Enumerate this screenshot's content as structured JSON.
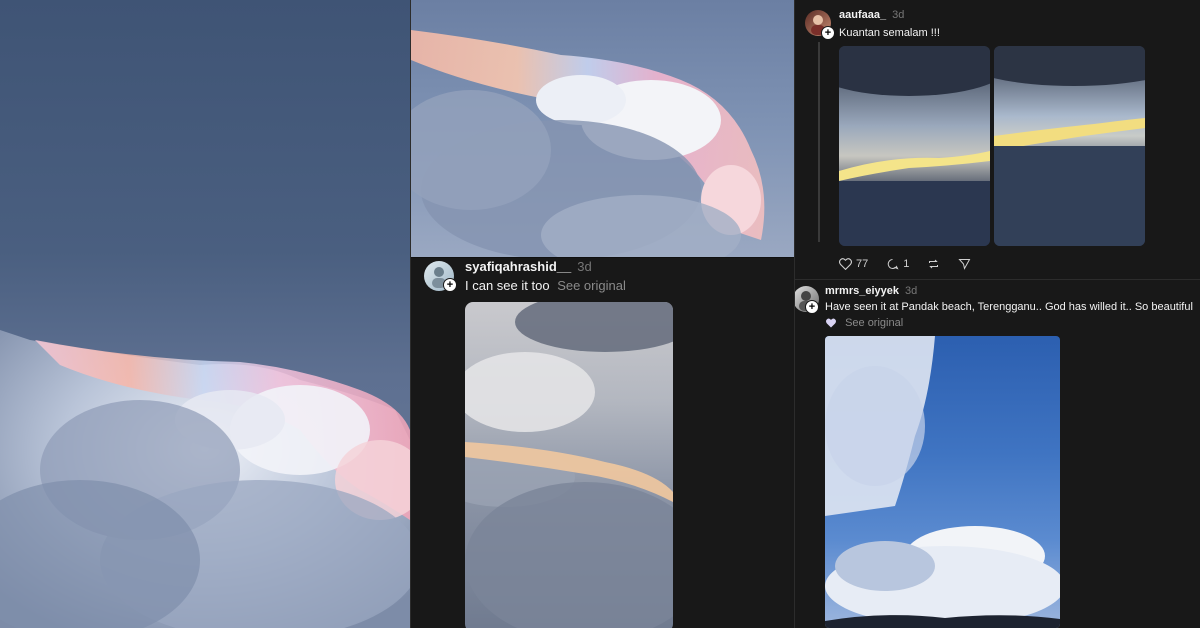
{
  "post_syafiqah": {
    "username": "syafiqahrashid__",
    "time": "3d",
    "text": "I can see it too",
    "see_original": "See original"
  },
  "post_aaufaaa": {
    "username": "aaufaaa_",
    "time": "3d",
    "text": "Kuantan semalam !!!",
    "likes": "77",
    "replies": "1"
  },
  "post_mrmrs": {
    "username": "mrmrs_eiyyek",
    "time": "3d",
    "text": "Have seen it at Pandak beach, Terengganu.. God has willed it.. So beautiful",
    "see_original": "See original"
  },
  "icons": [
    "heart-icon",
    "reply-icon",
    "repost-icon",
    "share-icon",
    "follow-plus-icon"
  ]
}
